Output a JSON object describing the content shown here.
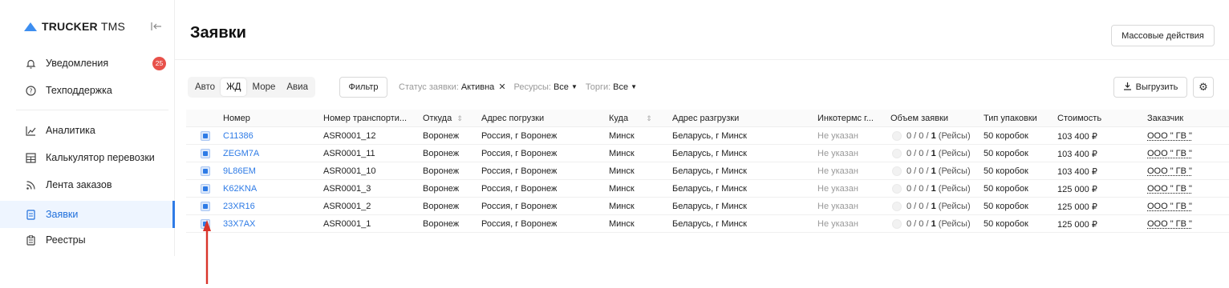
{
  "app": {
    "brand_bold": "TRUCKER",
    "brand_light": "TMS"
  },
  "sidebar": {
    "items": [
      {
        "label": "Уведомления",
        "icon": "bell-icon",
        "badge": "25"
      },
      {
        "label": "Техподдержка",
        "icon": "help-icon"
      },
      {
        "label": "Аналитика",
        "icon": "chart-icon"
      },
      {
        "label": "Калькулятор перевозки",
        "icon": "calculator-icon"
      },
      {
        "label": "Лента заказов",
        "icon": "feed-icon"
      },
      {
        "label": "Заявки",
        "icon": "requests-icon",
        "active": true
      },
      {
        "label": "Реестры",
        "icon": "registry-icon"
      }
    ]
  },
  "header": {
    "title": "Заявки",
    "mass_actions": "Массовые действия"
  },
  "toolbar": {
    "transport_tabs": [
      "Авто",
      "ЖД",
      "Море",
      "Авиа"
    ],
    "selected_tab": "ЖД",
    "filter_label": "Фильтр",
    "status_label": "Статус заявки:",
    "status_value": "Активна",
    "resources_label": "Ресурсы:",
    "resources_value": "Все",
    "auction_label": "Торги:",
    "auction_value": "Все",
    "export_label": "Выгрузить"
  },
  "table": {
    "headers": [
      "Номер",
      "Номер транспорти...",
      "Откуда",
      "Адрес погрузки",
      "Куда",
      "Адрес разгрузки",
      "Инкотермс г...",
      "Объем заявки",
      "Тип упаковки",
      "Стоимость",
      "Заказчик"
    ],
    "rows": [
      {
        "num": "C11386",
        "transport": "ASR0001_12",
        "from": "Воронеж",
        "load": "Россия, г Воронеж",
        "to": "Минск",
        "unload": "Беларусь, г Минск",
        "inco": "Не указан",
        "vol_a": "0 / 0 /",
        "vol_b": "1",
        "vol_c": "(Рейсы)",
        "pack": "50 коробок",
        "cost": "103 400 ₽",
        "cust": "ООО \" ГВ \""
      },
      {
        "num": "ZEGM7A",
        "transport": "ASR0001_11",
        "from": "Воронеж",
        "load": "Россия, г Воронеж",
        "to": "Минск",
        "unload": "Беларусь, г Минск",
        "inco": "Не указан",
        "vol_a": "0 / 0 /",
        "vol_b": "1",
        "vol_c": "(Рейсы)",
        "pack": "50 коробок",
        "cost": "103 400 ₽",
        "cust": "ООО \" ГВ \""
      },
      {
        "num": "9L86EM",
        "transport": "ASR0001_10",
        "from": "Воронеж",
        "load": "Россия, г Воронеж",
        "to": "Минск",
        "unload": "Беларусь, г Минск",
        "inco": "Не указан",
        "vol_a": "0 / 0 /",
        "vol_b": "1",
        "vol_c": "(Рейсы)",
        "pack": "50 коробок",
        "cost": "103 400 ₽",
        "cust": "ООО \" ГВ \""
      },
      {
        "num": "K62KNA",
        "transport": "ASR0001_3",
        "from": "Воронеж",
        "load": "Россия, г Воронеж",
        "to": "Минск",
        "unload": "Беларусь, г Минск",
        "inco": "Не указан",
        "vol_a": "0 / 0 /",
        "vol_b": "1",
        "vol_c": "(Рейсы)",
        "pack": "50 коробок",
        "cost": "125 000 ₽",
        "cust": "ООО \" ГВ \""
      },
      {
        "num": "23XR16",
        "transport": "ASR0001_2",
        "from": "Воронеж",
        "load": "Россия, г Воронеж",
        "to": "Минск",
        "unload": "Беларусь, г Минск",
        "inco": "Не указан",
        "vol_a": "0 / 0 /",
        "vol_b": "1",
        "vol_c": "(Рейсы)",
        "pack": "50 коробок",
        "cost": "125 000 ₽",
        "cust": "ООО \" ГВ \""
      },
      {
        "num": "33X7AX",
        "transport": "ASR0001_1",
        "from": "Воронеж",
        "load": "Россия, г Воронеж",
        "to": "Минск",
        "unload": "Беларусь, г Минск",
        "inco": "Не указан",
        "vol_a": "0 / 0 /",
        "vol_b": "1",
        "vol_c": "(Рейсы)",
        "pack": "50 коробок",
        "cost": "125 000 ₽",
        "cust": "ООО \" ГВ \""
      }
    ]
  },
  "colors": {
    "accent": "#2e7be6",
    "badge": "#e8514a",
    "annotation_arrow": "#d9342b"
  }
}
